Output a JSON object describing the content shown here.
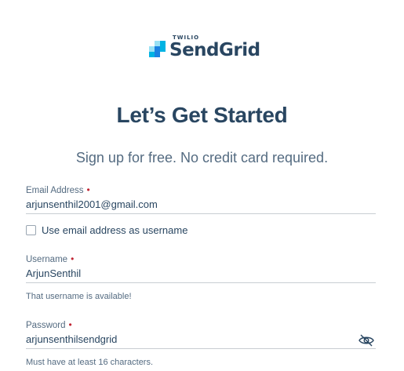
{
  "logo": {
    "brand_small": "TWILIO",
    "brand_name": "SendGrid",
    "colors": [
      "#1a82e2",
      "#00b3e3",
      "#99e1f4",
      "#263746"
    ]
  },
  "page": {
    "title": "Let’s Get Started",
    "subtitle": "Sign up for free. No credit card required."
  },
  "form": {
    "email": {
      "label": "Email Address",
      "required_marker": "•",
      "value": "arjunsenthil2001@gmail.com"
    },
    "use_email_checkbox": {
      "label": "Use email address as username",
      "checked": false
    },
    "username": {
      "label": "Username",
      "required_marker": "•",
      "value": "ArjunSenthil",
      "helper": "That username is available!"
    },
    "password": {
      "label": "Password",
      "required_marker": "•",
      "value": "arjunsenthilsendgrid",
      "helper": "Must have at least 16 characters.",
      "toggle_icon": "eye-off-icon"
    }
  },
  "colors": {
    "heading": "#294661",
    "muted": "#546b81",
    "required": "#c02533",
    "border": "#c8cdd2"
  }
}
